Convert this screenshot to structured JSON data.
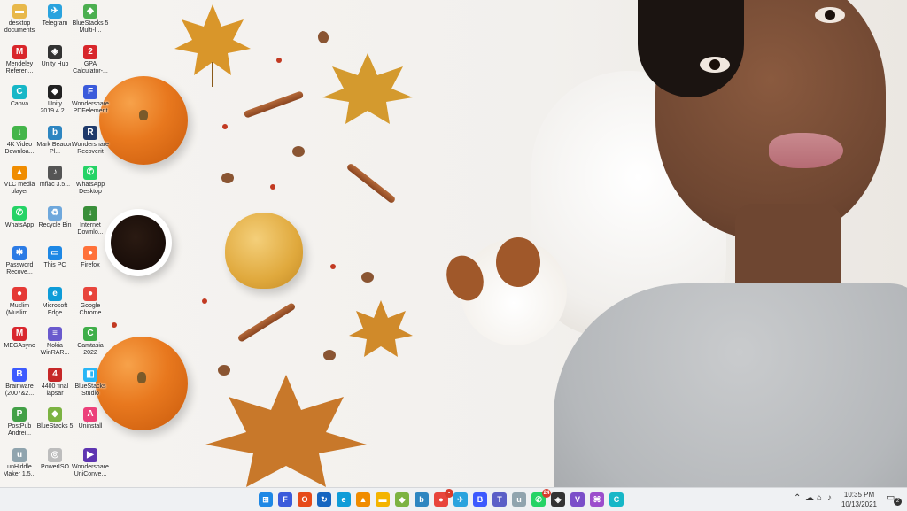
{
  "desktop_icons": [
    {
      "label": "desktop documents",
      "icon": "folder-icon",
      "color": "#e8b84a",
      "glyph": "▬"
    },
    {
      "label": "Telegram",
      "icon": "telegram-icon",
      "color": "#2aa3de",
      "glyph": "✈"
    },
    {
      "label": "BlueStacks 5 Multi-I...",
      "icon": "bluestacks-multi-icon",
      "color": "#4caf50",
      "glyph": "◆"
    },
    {
      "label": "Mendeley Referen...",
      "icon": "mendeley-icon",
      "color": "#d9262b",
      "glyph": "M"
    },
    {
      "label": "Unity Hub",
      "icon": "unity-hub-icon",
      "color": "#333333",
      "glyph": "◈"
    },
    {
      "label": "GPA Calculator-...",
      "icon": "gpa-calculator-icon",
      "color": "#d8262b",
      "glyph": "2"
    },
    {
      "label": "Canva",
      "icon": "canva-icon",
      "color": "#17b7c7",
      "glyph": "C"
    },
    {
      "label": "Unity 2019.4.2...",
      "icon": "unity-icon",
      "color": "#222222",
      "glyph": "◆"
    },
    {
      "label": "Wondershare PDFelement",
      "icon": "pdfelement-icon",
      "color": "#3b5bdb",
      "glyph": "F"
    },
    {
      "label": "4K Video Downloa...",
      "icon": "4k-video-icon",
      "color": "#44b54a",
      "glyph": "↓"
    },
    {
      "label": "Mark Beacon Pl...",
      "icon": "beacon-icon",
      "color": "#2e86c1",
      "glyph": "b"
    },
    {
      "label": "Wondershare Recoverit",
      "icon": "recoverit-icon",
      "color": "#1f3a6b",
      "glyph": "R"
    },
    {
      "label": "VLC media player",
      "icon": "vlc-icon",
      "color": "#f08c00",
      "glyph": "▲"
    },
    {
      "label": "mflac 3.5...",
      "icon": "mflac-icon",
      "color": "#555555",
      "glyph": "♪"
    },
    {
      "label": "WhatsApp Desktop",
      "icon": "whatsapp-desktop-icon",
      "color": "#25d366",
      "glyph": "✆"
    },
    {
      "label": "WhatsApp",
      "icon": "whatsapp-icon",
      "color": "#25d366",
      "glyph": "✆"
    },
    {
      "label": "Recycle Bin",
      "icon": "recycle-bin-icon",
      "color": "#6fa8dc",
      "glyph": "♻"
    },
    {
      "label": "Internet Downlo...",
      "icon": "internet-download-icon",
      "color": "#3a8f3a",
      "glyph": "↓"
    },
    {
      "label": "Password Recove...",
      "icon": "password-recovery-icon",
      "color": "#2c7be5",
      "glyph": "✱"
    },
    {
      "label": "This PC",
      "icon": "this-pc-icon",
      "color": "#1e88e5",
      "glyph": "▭"
    },
    {
      "label": "Firefox",
      "icon": "firefox-icon",
      "color": "#ff7139",
      "glyph": "●"
    },
    {
      "label": "Muslim (Muslim...",
      "icon": "muslim-app-icon",
      "color": "#e53935",
      "glyph": "●"
    },
    {
      "label": "Microsoft Edge",
      "icon": "edge-icon",
      "color": "#0f9cd8",
      "glyph": "e"
    },
    {
      "label": "Google Chrome",
      "icon": "chrome-icon",
      "color": "#e8453c",
      "glyph": "●"
    },
    {
      "label": "MEGAsync",
      "icon": "megasync-icon",
      "color": "#d9272e",
      "glyph": "M"
    },
    {
      "label": "Nokia WinRAR...",
      "icon": "winrar-icon",
      "color": "#6a5acd",
      "glyph": "≡"
    },
    {
      "label": "Camtasia 2022",
      "icon": "camtasia-icon",
      "color": "#3fae49",
      "glyph": "C"
    },
    {
      "label": "Brainware (2007&2...",
      "icon": "brainware-icon",
      "color": "#3d5afe",
      "glyph": "B"
    },
    {
      "label": "4400 final lapsar",
      "icon": "final-lapsar-icon",
      "color": "#c62828",
      "glyph": "4"
    },
    {
      "label": "BlueStacks Studio",
      "icon": "bluestacks-studio-icon",
      "color": "#29b6f6",
      "glyph": "◧"
    },
    {
      "label": "PostPub Andrei...",
      "icon": "postpub-icon",
      "color": "#43a047",
      "glyph": "P"
    },
    {
      "label": "BlueStacks 5",
      "icon": "bluestacks-icon",
      "color": "#7cb342",
      "glyph": "◆"
    },
    {
      "label": "Uninstall",
      "icon": "uninstall-icon",
      "color": "#ec407a",
      "glyph": "A"
    },
    {
      "label": "unHiddle Maker 1.5...",
      "icon": "unhiddle-icon",
      "color": "#90a4ae",
      "glyph": "u"
    },
    {
      "label": "PowerISO",
      "icon": "poweriso-icon",
      "color": "#bdbdbd",
      "glyph": "◎"
    },
    {
      "label": "Wondershare UniConve...",
      "icon": "uniconverter-icon",
      "color": "#5e35b1",
      "glyph": "▶"
    }
  ],
  "taskbar": {
    "apps": [
      {
        "name": "start-button",
        "color": "#1e88e5",
        "glyph": "⊞",
        "badge": ""
      },
      {
        "name": "taskbar-app-pdfelement",
        "color": "#3b5bdb",
        "glyph": "F",
        "badge": ""
      },
      {
        "name": "taskbar-app-office",
        "color": "#e64a19",
        "glyph": "O",
        "badge": ""
      },
      {
        "name": "taskbar-app-recycle",
        "color": "#1565c0",
        "glyph": "↻",
        "badge": ""
      },
      {
        "name": "taskbar-app-edge",
        "color": "#0f9cd8",
        "glyph": "e",
        "badge": ""
      },
      {
        "name": "taskbar-app-vlc",
        "color": "#f08c00",
        "glyph": "▲",
        "badge": ""
      },
      {
        "name": "taskbar-app-explorer",
        "color": "#f4b400",
        "glyph": "▬",
        "badge": ""
      },
      {
        "name": "taskbar-app-bluestacks",
        "color": "#7cb342",
        "glyph": "◆",
        "badge": ""
      },
      {
        "name": "taskbar-app-beacon",
        "color": "#2e86c1",
        "glyph": "b",
        "badge": ""
      },
      {
        "name": "taskbar-app-chrome",
        "color": "#e8453c",
        "glyph": "●",
        "badge": "•"
      },
      {
        "name": "taskbar-app-telegram",
        "color": "#2aa3de",
        "glyph": "✈",
        "badge": ""
      },
      {
        "name": "taskbar-app-brainware",
        "color": "#3d5afe",
        "glyph": "B",
        "badge": ""
      },
      {
        "name": "taskbar-app-teams",
        "color": "#5b5fc7",
        "glyph": "T",
        "badge": ""
      },
      {
        "name": "taskbar-app-unhiddle",
        "color": "#90a4ae",
        "glyph": "u",
        "badge": ""
      },
      {
        "name": "taskbar-app-whatsapp",
        "color": "#25d366",
        "glyph": "✆",
        "badge": "24"
      },
      {
        "name": "taskbar-app-unity",
        "color": "#333333",
        "glyph": "◈",
        "badge": ""
      },
      {
        "name": "taskbar-app-visualstudio",
        "color": "#7b4fc9",
        "glyph": "V",
        "badge": ""
      },
      {
        "name": "taskbar-app-vscode-purple",
        "color": "#9c4dcc",
        "glyph": "⌘",
        "badge": ""
      },
      {
        "name": "taskbar-app-canva",
        "color": "#17b7c7",
        "glyph": "C",
        "badge": ""
      }
    ],
    "tray": {
      "time": "10:35 PM",
      "date": "10/13/2021",
      "notification_count": "2"
    }
  }
}
